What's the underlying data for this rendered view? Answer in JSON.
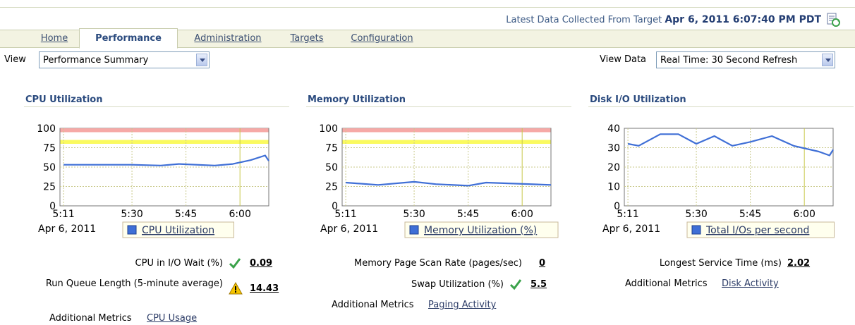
{
  "header": {
    "collected_label": "Latest Data Collected From Target",
    "collected_value": "Apr 6, 2011 6:07:40 PM PDT"
  },
  "tabs": [
    {
      "label": "Home",
      "active": false
    },
    {
      "label": "Performance",
      "active": true
    },
    {
      "label": "Administration",
      "active": false
    },
    {
      "label": "Targets",
      "active": false
    },
    {
      "label": "Configuration",
      "active": false
    }
  ],
  "view": {
    "label": "View",
    "selected": "Performance Summary"
  },
  "view_data": {
    "label": "View Data",
    "selected": "Real Time: 30 Second Refresh"
  },
  "colors": {
    "series": "#3f6fd6",
    "critical_band": "#f6a9a6",
    "warning_band": "#fafa5e",
    "gridline": "#c9c98a"
  },
  "cpu": {
    "title": "CPU Utilization",
    "metrics": [
      {
        "label": "CPU in I/O Wait (%)",
        "value": "0.09",
        "status": "check-icon"
      },
      {
        "label": "Run Queue Length (5-minute average)",
        "value": "14.43",
        "status": "warning-icon"
      }
    ],
    "additional_label": "Additional Metrics",
    "additional_link": "CPU Usage"
  },
  "memory": {
    "title": "Memory Utilization",
    "metrics": [
      {
        "label": "Memory Page Scan Rate (pages/sec)",
        "value": "0",
        "status": ""
      },
      {
        "label": "Swap Utilization (%)",
        "value": "5.5",
        "status": "check-icon"
      }
    ],
    "additional_label": "Additional Metrics",
    "additional_link": "Paging Activity"
  },
  "disk": {
    "title": "Disk I/O Utilization",
    "metrics": [
      {
        "label": "Longest Service Time (ms)",
        "value": "2.02",
        "status": ""
      }
    ],
    "additional_label": "Additional Metrics",
    "additional_link": "Disk Activity"
  },
  "chart_data": [
    {
      "type": "line",
      "ylim": [
        0,
        100
      ],
      "yticks": [
        "100",
        "75",
        "50",
        "25",
        "0"
      ],
      "xticks": [
        "5:11",
        "5:30",
        "5:45",
        "6:00"
      ],
      "date_label": "Apr 6, 2011",
      "legend": "CPU Utilization",
      "critical_band": [
        95,
        100
      ],
      "warning_band": [
        80,
        85
      ],
      "x": [
        "5:11",
        "5:20",
        "5:30",
        "5:38",
        "5:43",
        "5:53",
        "5:58",
        "6:03",
        "6:07",
        "6:08"
      ],
      "y": [
        53,
        53,
        53,
        52,
        54,
        52,
        54,
        59,
        65,
        58
      ]
    },
    {
      "type": "line",
      "ylim": [
        0,
        100
      ],
      "yticks": [
        "100",
        "75",
        "50",
        "25",
        "0"
      ],
      "xticks": [
        "5:11",
        "5:30",
        "5:45",
        "6:00"
      ],
      "date_label": "Apr 6, 2011",
      "legend": "Memory Utilization (%)",
      "critical_band": [
        95,
        100
      ],
      "warning_band": [
        80,
        85
      ],
      "x": [
        "5:11",
        "5:20",
        "5:30",
        "5:36",
        "5:45",
        "5:50",
        "6:08"
      ],
      "y": [
        30,
        27,
        31,
        28,
        26,
        30,
        27
      ]
    },
    {
      "type": "line",
      "ylim": [
        0,
        40
      ],
      "yticks": [
        "40",
        "30",
        "20",
        "10",
        "0"
      ],
      "xticks": [
        "5:11",
        "5:30",
        "5:45",
        "6:00"
      ],
      "date_label": "Apr 6, 2011",
      "legend": "Total I/Os per second",
      "x": [
        "5:11",
        "5:14",
        "5:20",
        "5:25",
        "5:30",
        "5:35",
        "5:40",
        "5:45",
        "5:51",
        "5:57",
        "6:04",
        "6:07",
        "6:08"
      ],
      "y": [
        32,
        31,
        37,
        37,
        32,
        36,
        31,
        33,
        36,
        31,
        28,
        26,
        29
      ]
    }
  ]
}
